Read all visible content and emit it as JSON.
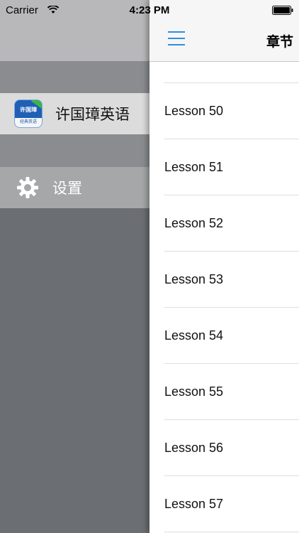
{
  "status_bar": {
    "carrier": "Carrier",
    "time": "4:23 PM"
  },
  "drawer": {
    "items": [
      {
        "label": "许国璋英语",
        "icon": "app-logo-icon",
        "icon_text_top": "许国璋",
        "icon_text_bottom": "经典英语"
      },
      {
        "label": "设置",
        "icon": "gear-icon"
      }
    ]
  },
  "nav": {
    "title": "章节",
    "menu_icon": "hamburger-menu-icon"
  },
  "lessons": [
    "Lesson 50",
    "Lesson 51",
    "Lesson 52",
    "Lesson 53",
    "Lesson 54",
    "Lesson 55",
    "Lesson 56",
    "Lesson 57"
  ],
  "colors": {
    "accent": "#2e8ee0",
    "drawer_bg": "#6b6e72",
    "selected_item_bg": "#dcdcdc"
  }
}
